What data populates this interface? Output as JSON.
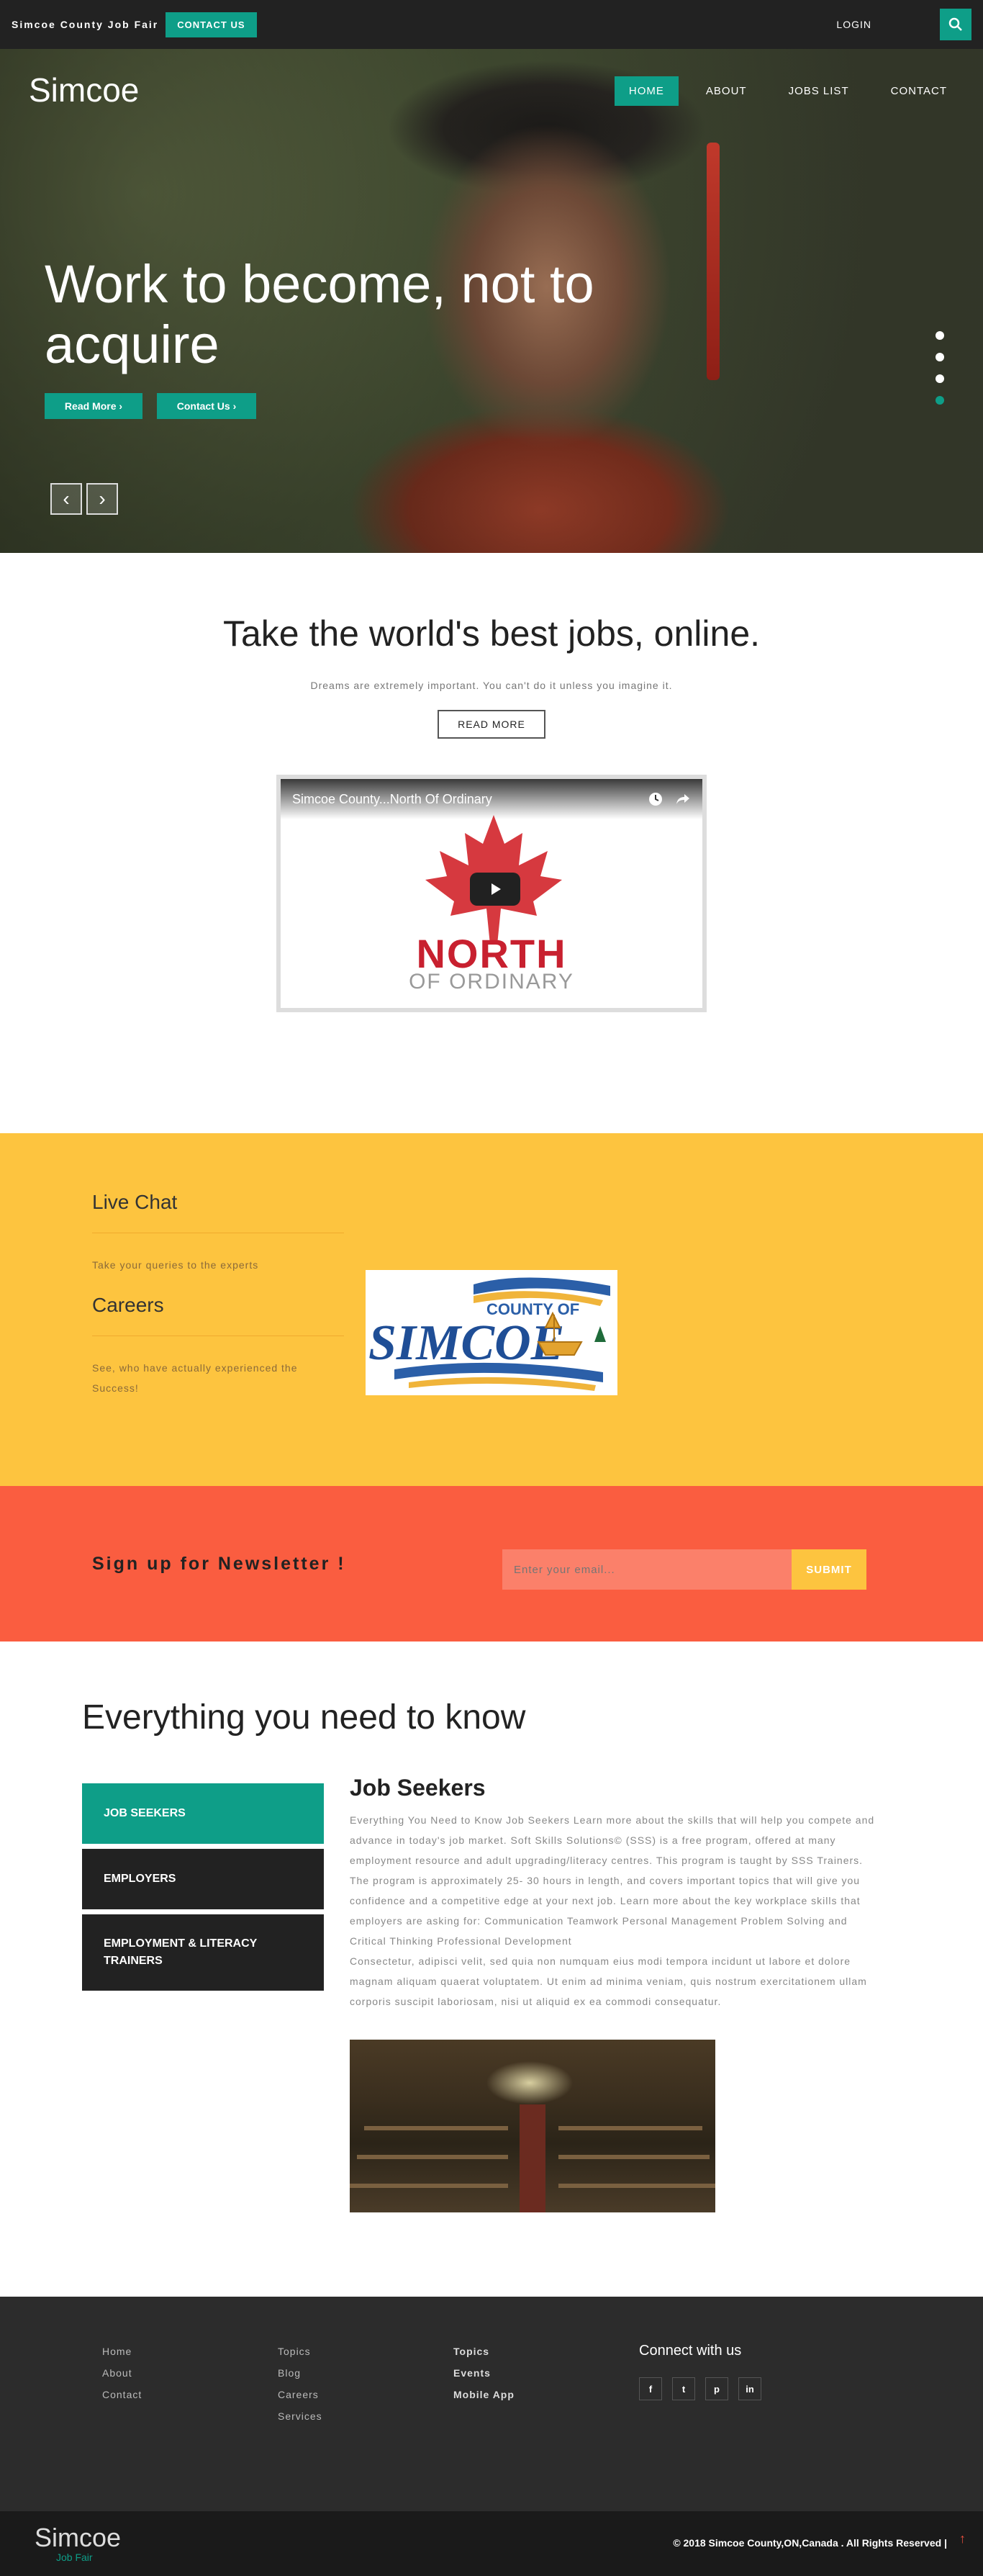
{
  "topbar": {
    "brand": "Simcoe County Job Fair",
    "contact_label": "CONTACT US",
    "login_label": "LOGIN",
    "search_icon": "search-icon"
  },
  "hero": {
    "logo": "Simcoe",
    "nav": [
      "HOME",
      "ABOUT",
      "JOBS LIST",
      "CONTACT"
    ],
    "active_nav": "HOME",
    "headline": "Work to become, not to acquire",
    "read_more": "Read More",
    "contact_us": "Contact Us",
    "slides_total": 4,
    "active_slide": 4
  },
  "intro": {
    "title": "Take the world's best jobs, online.",
    "subtitle": "Dreams are extremely important. You can't do it unless you imagine it.",
    "read_more": "READ MORE",
    "video_title": "Simcoe County...North Of Ordinary",
    "video_brand_main": "NORTH",
    "video_brand_sub": "OF ORDINARY"
  },
  "info": {
    "live_chat_title": "Live Chat",
    "live_chat_text": "Take your queries to the experts",
    "careers_title": "Careers",
    "careers_text": "See, who have actually experienced the Success!",
    "logo_top": "COUNTY OF",
    "logo_main": "SIMCOE"
  },
  "newsletter": {
    "label": "Sign up for Newsletter !",
    "placeholder": "Enter your email...",
    "submit": "SUBMIT"
  },
  "know": {
    "title": "Everything you need to know",
    "tabs": [
      "JOB SEEKERS",
      "EMPLOYERS",
      "EMPLOYMENT & LITERACY TRAINERS"
    ],
    "active_tab": "JOB SEEKERS",
    "content_title": "Job Seekers",
    "content_p1": "Everything You Need to Know Job Seekers Learn more about the skills that will help you compete and advance in today's job market. Soft Skills Solutions© (SSS) is a free program, offered at many employment resource and adult upgrading/literacy centres. This program is taught by SSS Trainers. The program is approximately 25- 30 hours in length, and covers important topics that will give you confidence and a competitive edge at your next job. Learn more about the key workplace skills that employers are asking for: Communication Teamwork Personal Management Problem Solving and Critical Thinking Professional Development",
    "content_p2": "Consectetur, adipisci velit, sed quia non numquam eius modi tempora incidunt ut labore et dolore magnam aliquam quaerat voluptatem. Ut enim ad minima veniam, quis nostrum exercitationem ullam corporis suscipit laboriosam, nisi ut aliquid ex ea commodi consequatur."
  },
  "footer": {
    "col1": [
      "Home",
      "About",
      "Contact"
    ],
    "col2": [
      "Topics",
      "Blog",
      "Careers",
      "Services"
    ],
    "col3": [
      "Topics",
      "Events",
      "Mobile App"
    ],
    "connect": "Connect with us",
    "social": [
      "f",
      "t",
      "p",
      "in"
    ]
  },
  "bottom": {
    "logo": "Simcoe",
    "sub": "Job Fair",
    "copyright": "© 2018 Simcoe County,ON,Canada . All Rights Reserved |"
  }
}
